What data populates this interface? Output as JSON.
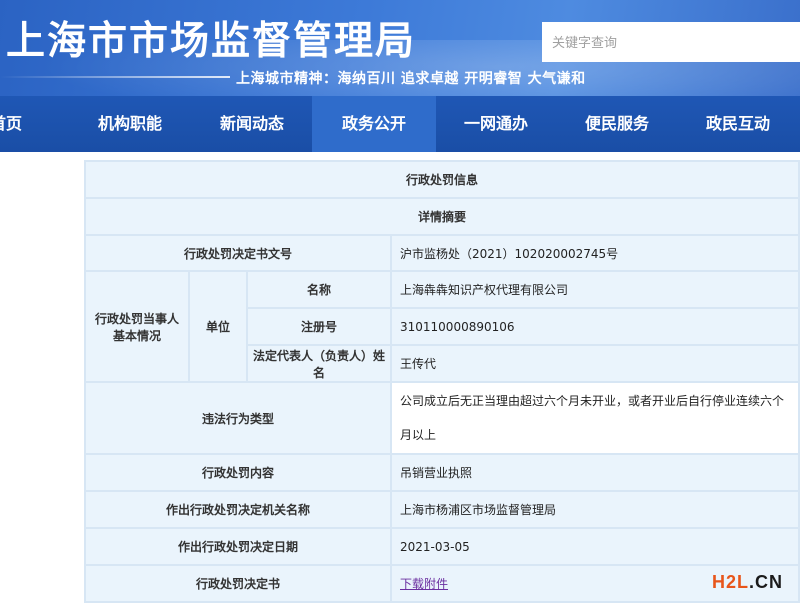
{
  "header": {
    "site_title": "上海市市场监督管理局",
    "search_placeholder": "关键字查询",
    "spirit": "上海城市精神：海纳百川  追求卓越  开明睿智  大气谦和"
  },
  "nav": {
    "items": [
      "首页",
      "机构职能",
      "新闻动态",
      "政务公开",
      "一网通办",
      "便民服务",
      "政民互动"
    ],
    "active": "政务公开"
  },
  "record": {
    "title": "行政处罚信息",
    "subtitle": "详情摘要",
    "doc_no_label": "行政处罚决定书文号",
    "doc_no_value": "沪市监杨处（2021）102020002745号",
    "party_label": "行政处罚当事人基本情况",
    "unit_label": "单位",
    "name_label": "名称",
    "name_value": "上海犇犇知识产权代理有限公司",
    "reg_label": "注册号",
    "reg_value": "310110000890106",
    "rep_label": "法定代表人（负责人）姓名",
    "rep_value": "王传代",
    "violation_label": "违法行为类型",
    "violation_value": "公司成立后无正当理由超过六个月未开业，或者开业后自行停业连续六个月以上",
    "content_label": "行政处罚内容",
    "content_value": "吊销营业执照",
    "authority_label": "作出行政处罚决定机关名称",
    "authority_value": "上海市杨浦区市场监督管理局",
    "date_label": "作出行政处罚决定日期",
    "date_value": "2021-03-05",
    "decision_label": "行政处罚决定书",
    "decision_link": "下载附件"
  },
  "watermark": {
    "part_a": "H2L",
    "part_b": ".CN"
  }
}
